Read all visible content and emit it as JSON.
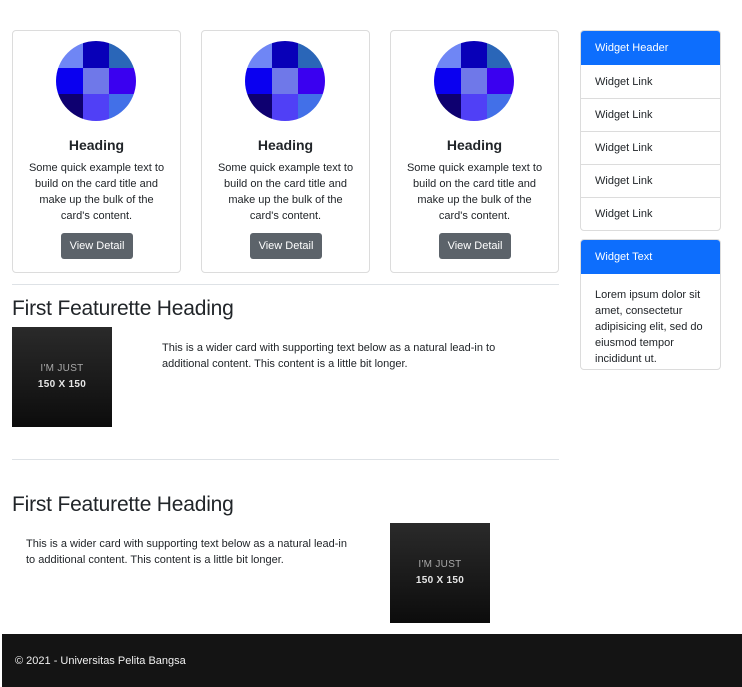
{
  "cards": [
    {
      "heading": "Heading",
      "text": "Some quick example text to build on the card title and make up the bulk of the card's content.",
      "button": "View Detail"
    },
    {
      "heading": "Heading",
      "text": "Some quick example text to build on the card title and make up the bulk of the card's content.",
      "button": "View Detail"
    },
    {
      "heading": "Heading",
      "text": "Some quick example text to build on the card title and make up the bulk of the card's content.",
      "button": "View Detail"
    }
  ],
  "avatar_colors": [
    "#6f86f5",
    "#0800b8",
    "#2a66b8",
    "#0a00f0",
    "#6f78e9",
    "#3a00f0",
    "#0e0070",
    "#5040f6",
    "#4270e8"
  ],
  "featurettes": [
    {
      "heading": "First Featurette Heading",
      "text": "This is a wider card with supporting text below as a natural lead-in to additional content. This content is a little bit longer.",
      "image_line1": "I'M JUST",
      "image_line2": "150 X 150"
    },
    {
      "heading": "First Featurette Heading",
      "text": "This is a wider card with supporting text below as a natural lead-in to additional content. This content is a little bit longer.",
      "image_line1": "I'M JUST",
      "image_line2": "150 X 150"
    }
  ],
  "widget_links": {
    "header": "Widget Header",
    "links": [
      "Widget Link",
      "Widget Link",
      "Widget Link",
      "Widget Link",
      "Widget Link"
    ]
  },
  "widget_text": {
    "header": "Widget Text",
    "body": "Lorem ipsum dolor sit amet, consectetur adipisicing elit, sed do eiusmod tempor incididunt ut."
  },
  "footer": {
    "text": "© 2021 - Universitas Pelita Bangsa"
  },
  "colors": {
    "primary": "#0d6efd",
    "button": "#5c636a",
    "footer": "#141414"
  }
}
